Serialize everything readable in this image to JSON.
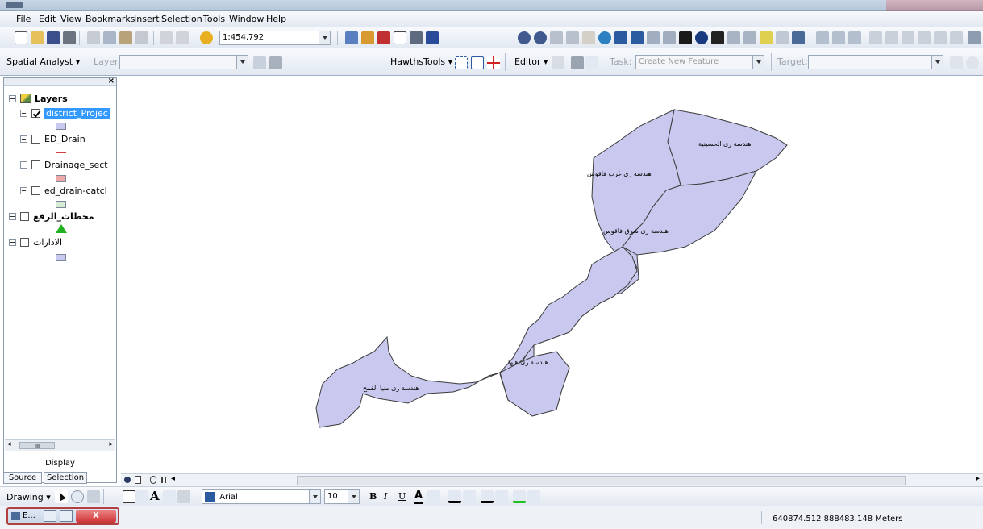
{
  "menubar": {
    "items": [
      "File",
      "Edit",
      "View",
      "Bookmarks",
      "Insert",
      "Selection",
      "Tools",
      "Window",
      "Help"
    ]
  },
  "toolbar1": {
    "scale_value": "1:454,792"
  },
  "toolbar2": {
    "spatial_analyst_label": "Spatial Analyst ▾",
    "layer_label": "Layer:",
    "hawths_tools_label": "HawthsTools ▾",
    "editor_label": "Editor ▾",
    "task_label": "Task:",
    "task_value": "Create New Feature",
    "target_label": "Target:"
  },
  "toc": {
    "root_label": "Layers",
    "layers": [
      {
        "name": "district_Projec",
        "checked": true,
        "selected": true,
        "swatch_color": "#c9c9ef"
      },
      {
        "name": "ED_Drain",
        "checked": false,
        "selected": false,
        "swatch_color": "#d04040"
      },
      {
        "name": "Drainage_sect",
        "checked": false,
        "selected": false,
        "swatch_color": "#f0a8a8"
      },
      {
        "name": "ed_drain-catcl",
        "checked": false,
        "selected": false,
        "swatch_color": "#d4ecd4"
      },
      {
        "name": "محطات_الرفع",
        "checked": false,
        "selected": false,
        "swatch_color": "#20b020"
      },
      {
        "name": "الادارات",
        "checked": false,
        "selected": false,
        "swatch_color": "#c9c9ef"
      }
    ],
    "scroll_label": "III",
    "tab_display": "Display",
    "tab_source": "Source",
    "tab_selection": "Selection"
  },
  "map": {
    "region_labels": [
      "هندسة رى الحسينية",
      "هندسة رى غرب فاقوس",
      "هندسة رى شرق فاقوس",
      "هندسة رى هيها",
      "هندسة رى منيا القمح"
    ],
    "fill_color": "#c9c9ef"
  },
  "drawbar": {
    "drawing_label": "Drawing ▾",
    "font_name": "Arial",
    "font_size": "10",
    "bold": "B",
    "italic": "I",
    "underline": "U",
    "font_color_letter": "A",
    "text_letter": "A"
  },
  "statusbar": {
    "task_title": "E...",
    "close_symbol": "X",
    "coordinates": "640874.512  888483.148 Meters"
  }
}
